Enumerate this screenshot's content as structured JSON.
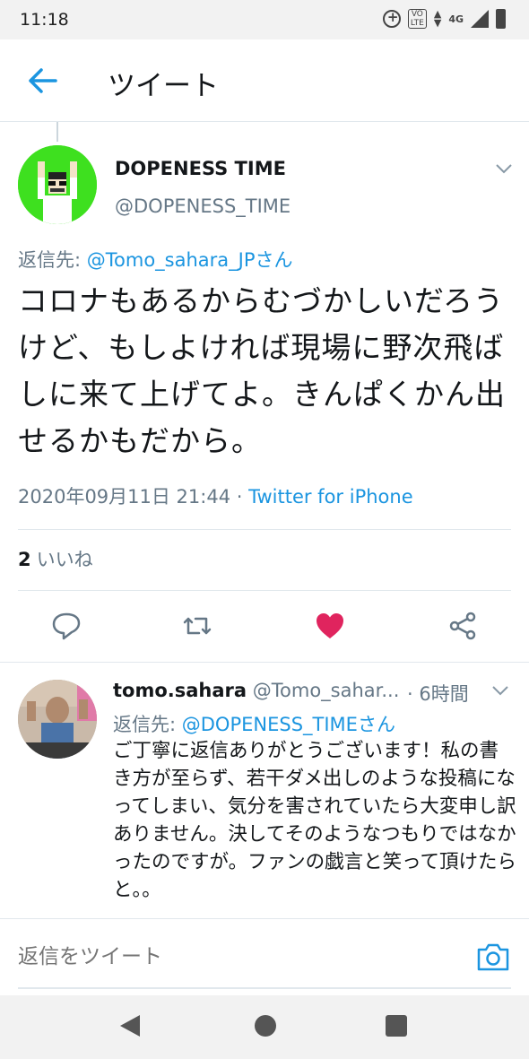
{
  "status_bar": {
    "time": "11:18",
    "volte": "VO LTE",
    "network": "4G"
  },
  "header": {
    "title": "ツイート"
  },
  "tweet": {
    "author_name": "DOPENESS TIME",
    "author_handle": "@DOPENESS_TIME",
    "reply_prefix": "返信先: ",
    "reply_to": "@Tomo_sahara_JPさん",
    "text": "コロナもあるからむづかしいだろうけど、もしよければ現場に野次飛ばしに来て上げてよ。きんぱくかん出せるかもだから。",
    "date": "2020年09月11日 21:44",
    "separator": " · ",
    "source": "Twitter for iPhone",
    "like_count": "2",
    "like_label": "いいね",
    "liked_color": "#e0245e"
  },
  "reply": {
    "name": "tomo.sahara",
    "handle": " @Tomo_sahar...",
    "time": "· 6時間",
    "reply_prefix": "返信先: ",
    "reply_to": "@DOPENESS_TIMEさん",
    "text": "ご丁寧に返信ありがとうございます！私の書き方が至らず、若干ダメ出しのような投稿になってしまい、気分を害されていたら大変申し訳ありません。決してそのようなつもりではなかったのですが。ファンの戯言と笑って頂けたらと。。"
  },
  "compose": {
    "placeholder": "返信をツイート"
  },
  "colors": {
    "accent": "#1b95e0",
    "secondary_text": "#657786",
    "like": "#e0245e",
    "avatar_bg": "#3ee01f"
  }
}
